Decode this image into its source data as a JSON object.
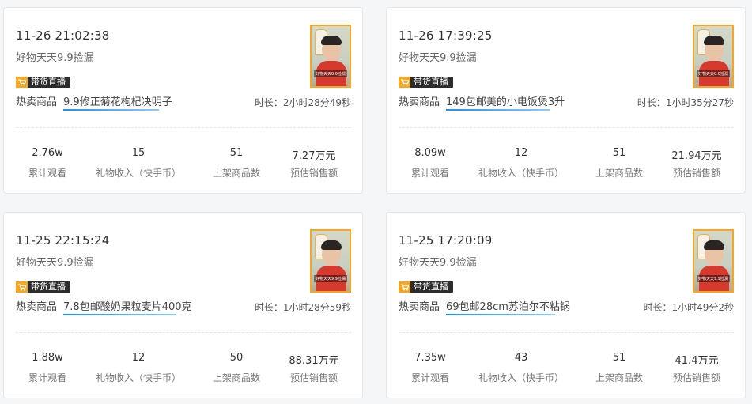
{
  "cards": [
    {
      "time": "11-26 21:02:38",
      "anchor": "好物天天9.9捡漏",
      "badge": "带货直播",
      "hot_label": "热卖商品",
      "product": "9.9修正菊花枸杞决明子",
      "duration": "时长：2小时28分49秒",
      "thumb_caption": "好物天天9.9捡漏",
      "stats": [
        {
          "value": "2.76w",
          "label": "累计观看"
        },
        {
          "value": "15",
          "label": "礼物收入（快手币）"
        },
        {
          "value": "51",
          "label": "上架商品数"
        },
        {
          "value": "7.27万元",
          "label": "预估销售额"
        }
      ]
    },
    {
      "time": "11-26 17:39:25",
      "anchor": "好物天天9.9捡漏",
      "badge": "带货直播",
      "hot_label": "热卖商品",
      "product": "149包邮美的小电饭煲3升",
      "duration": "时长：1小时35分27秒",
      "thumb_caption": "好物天天9.9捡漏",
      "stats": [
        {
          "value": "8.09w",
          "label": "累计观看"
        },
        {
          "value": "12",
          "label": "礼物收入（快手币）"
        },
        {
          "value": "51",
          "label": "上架商品数"
        },
        {
          "value": "21.94万元",
          "label": "预估销售额"
        }
      ]
    },
    {
      "time": "11-25 22:15:24",
      "anchor": "好物天天9.9捡漏",
      "badge": "带货直播",
      "hot_label": "热卖商品",
      "product": "7.8包邮酸奶果粒麦片400克",
      "duration": "时长：1小时28分59秒",
      "thumb_caption": "好物天天9.9捡漏",
      "stats": [
        {
          "value": "1.88w",
          "label": "累计观看"
        },
        {
          "value": "12",
          "label": "礼物收入（快手币）"
        },
        {
          "value": "50",
          "label": "上架商品数"
        },
        {
          "value": "88.31万元",
          "label": "预估销售额"
        }
      ]
    },
    {
      "time": "11-25 17:20:09",
      "anchor": "好物天天9.9捡漏",
      "badge": "带货直播",
      "hot_label": "热卖商品",
      "product": "69包邮28cm苏泊尔不粘锅",
      "duration": "时长：1小时49分2秒",
      "thumb_caption": "好物天天9.9捡漏",
      "stats": [
        {
          "value": "7.35w",
          "label": "累计观看"
        },
        {
          "value": "43",
          "label": "礼物收入（快手币）"
        },
        {
          "value": "51",
          "label": "上架商品数"
        },
        {
          "value": "41.4万元",
          "label": "预估销售额"
        }
      ]
    }
  ],
  "colors": {
    "badge_icon": "#f5a623",
    "link_underline": "#1f8ff3",
    "thumb_border": "#f5a623"
  },
  "icons": {
    "badge": "shopping-cart-icon"
  }
}
